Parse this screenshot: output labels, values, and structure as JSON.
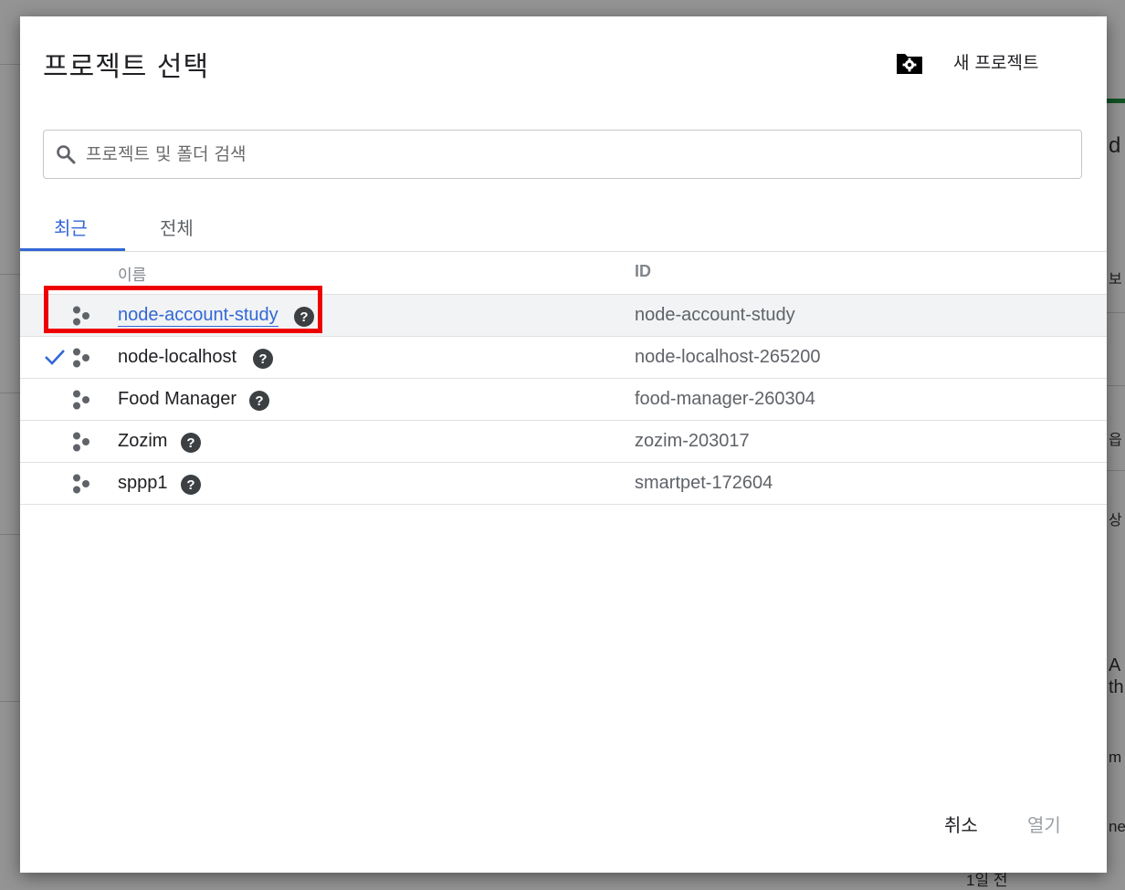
{
  "dialog": {
    "title": "프로젝트 선택",
    "new_project_label": "새 프로젝트",
    "new_project_icon": "folder-settings-icon"
  },
  "search": {
    "placeholder": "프로젝트 및 폴더 검색",
    "value": ""
  },
  "tabs": [
    {
      "label": "최근",
      "active": true
    },
    {
      "label": "전체",
      "active": false
    }
  ],
  "columns": {
    "name": "이름",
    "id": "ID"
  },
  "projects": [
    {
      "name": "node-account-study",
      "id": "node-account-study",
      "hovered": true,
      "selected": false
    },
    {
      "name": "node-localhost",
      "id": "node-localhost-265200",
      "hovered": false,
      "selected": true
    },
    {
      "name": "Food Manager",
      "id": "food-manager-260304",
      "hovered": false,
      "selected": false
    },
    {
      "name": "Zozim",
      "id": "zozim-203017",
      "hovered": false,
      "selected": false
    },
    {
      "name": "sppp1",
      "id": "smartpet-172604",
      "hovered": false,
      "selected": false
    }
  ],
  "buttons": {
    "cancel": "취소",
    "open": "열기"
  },
  "background_fragments": [
    "d",
    "보",
    "읍",
    "상",
    "A",
    "th",
    "m",
    "ne",
    "1일 전"
  ],
  "colors": {
    "accent": "#3367d6",
    "highlight_box": "#ee0000",
    "row_hover": "#f1f3f4"
  }
}
